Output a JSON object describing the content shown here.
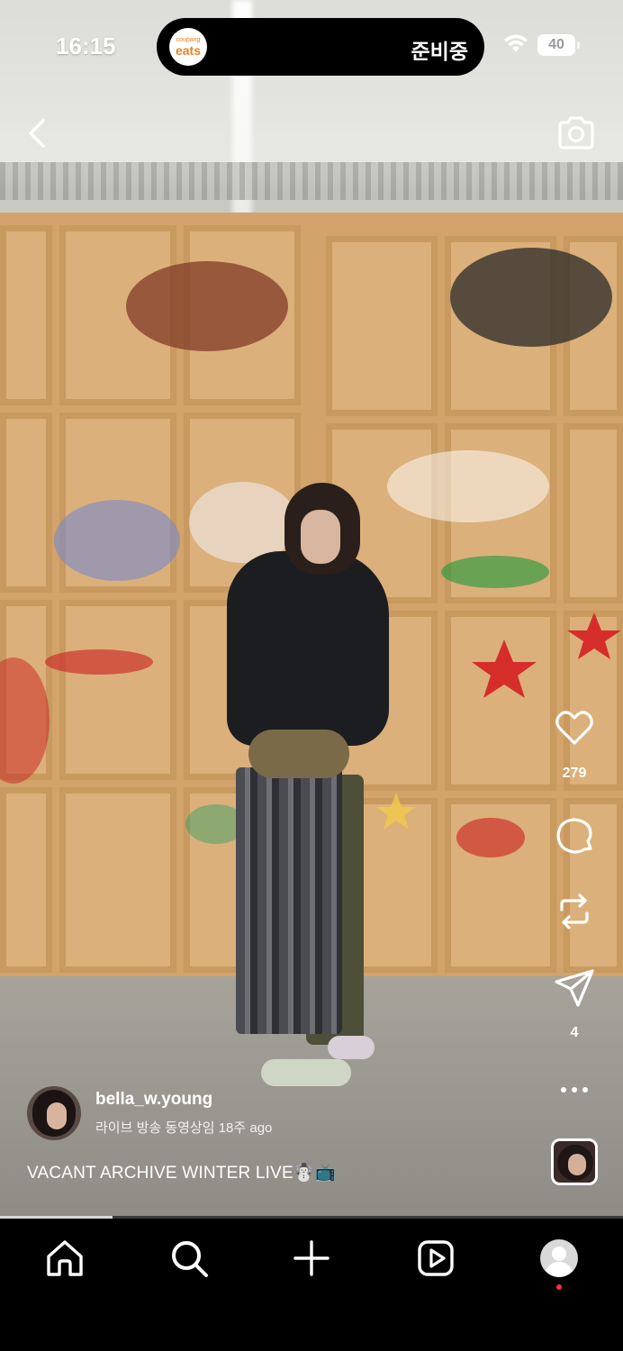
{
  "status_bar": {
    "time": "16:15",
    "activity_app_small": "coupang",
    "activity_app_big": "eats",
    "activity_text": "준비중",
    "battery": "40"
  },
  "reel": {
    "like_count": "279",
    "share_count": "4",
    "author": "bella_w.young",
    "subline": "라이브 방송 동영상임 18주 ago",
    "caption": "VACANT ARCHIVE WINTER LIVE☃️📺",
    "progress_fraction": 0.18
  },
  "icons": {
    "back": "chevron-left-icon",
    "camera": "camera-icon",
    "like": "heart-icon",
    "comment": "comment-icon",
    "repost": "repost-icon",
    "share": "send-icon",
    "more": "more-icon"
  },
  "bottom_nav": [
    "home",
    "search",
    "create",
    "reels",
    "profile"
  ],
  "colors": {
    "accent_red": "#ff3040",
    "nav_bg": "#000000"
  }
}
